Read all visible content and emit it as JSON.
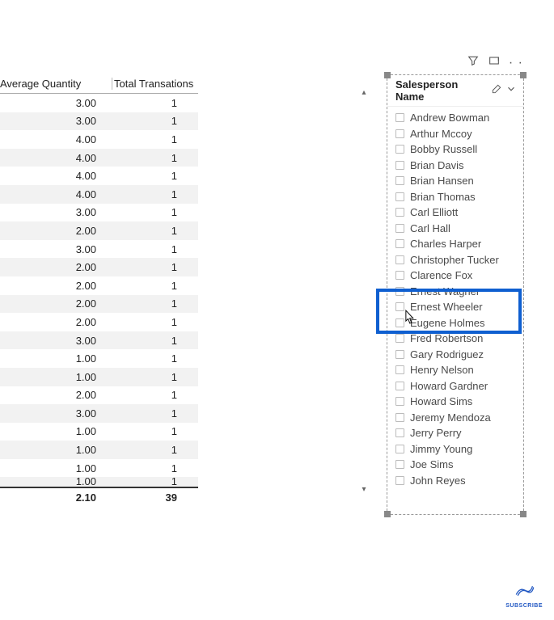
{
  "table": {
    "headers": {
      "qty": "Average Quantity",
      "trans": "Total Transations"
    },
    "rows": [
      {
        "qty": "3.00",
        "trans": "1"
      },
      {
        "qty": "3.00",
        "trans": "1"
      },
      {
        "qty": "4.00",
        "trans": "1"
      },
      {
        "qty": "4.00",
        "trans": "1"
      },
      {
        "qty": "4.00",
        "trans": "1"
      },
      {
        "qty": "4.00",
        "trans": "1"
      },
      {
        "qty": "3.00",
        "trans": "1"
      },
      {
        "qty": "2.00",
        "trans": "1"
      },
      {
        "qty": "3.00",
        "trans": "1"
      },
      {
        "qty": "2.00",
        "trans": "1"
      },
      {
        "qty": "2.00",
        "trans": "1"
      },
      {
        "qty": "2.00",
        "trans": "1"
      },
      {
        "qty": "2.00",
        "trans": "1"
      },
      {
        "qty": "3.00",
        "trans": "1"
      },
      {
        "qty": "1.00",
        "trans": "1"
      },
      {
        "qty": "1.00",
        "trans": "1"
      },
      {
        "qty": "2.00",
        "trans": "1"
      },
      {
        "qty": "3.00",
        "trans": "1"
      },
      {
        "qty": "1.00",
        "trans": "1"
      },
      {
        "qty": "1.00",
        "trans": "1"
      },
      {
        "qty": "1.00",
        "trans": "1"
      },
      {
        "qty": "1.00",
        "trans": "1"
      }
    ],
    "totals": {
      "qty": "2.10",
      "trans": "39"
    }
  },
  "slicer": {
    "title": "Salesperson Name",
    "items": [
      "Andrew Bowman",
      "Arthur Mccoy",
      "Bobby Russell",
      "Brian Davis",
      "Brian Hansen",
      "Brian Thomas",
      "Carl Elliott",
      "Carl Hall",
      "Charles Harper",
      "Christopher Tucker",
      "Clarence Fox",
      "Ernest Wagner",
      "Ernest Wheeler",
      "Eugene Holmes",
      "Fred Robertson",
      "Gary Rodriguez",
      "Henry Nelson",
      "Howard Gardner",
      "Howard Sims",
      "Jeremy Mendoza",
      "Jerry Perry",
      "Jimmy Young",
      "Joe Sims",
      "John Reyes"
    ]
  },
  "subscribe": "SUBSCRIBE"
}
